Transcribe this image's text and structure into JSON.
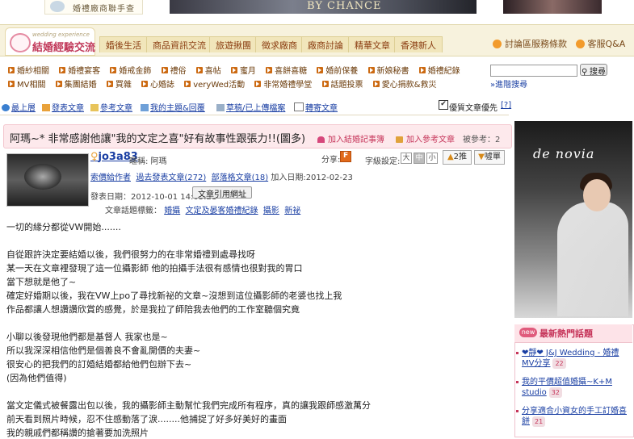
{
  "header": {
    "logo_text": "婚禮廠商聯手查",
    "banner_text": "BY CHANCE"
  },
  "nav": {
    "brand_sub": "wedding experience",
    "brand_title": "結婚經驗交流",
    "tabs": [
      "婚後生活",
      "商品資訊交流",
      "旅遊揪團",
      "徵求廠商",
      "廠商討論",
      "精華文章",
      "香港新人"
    ],
    "right_links": [
      "討論區服務條款",
      "客服Q&A"
    ]
  },
  "categories": {
    "row1": [
      "婚紗相關",
      "婚禮宴客",
      "婚戒金飾",
      "禮俗",
      "喜帖",
      "蜜月",
      "喜餅喜糖",
      "婚前保養",
      "新娘秘書",
      "婚禮紀錄"
    ],
    "row2": [
      "MV相關",
      "集團結婚",
      "買雜",
      "心婚誌",
      "veryWed活動",
      "非常婚禮學堂",
      "話題投票",
      "愛心捐款&救災"
    ]
  },
  "search": {
    "placeholder": "",
    "button_label": "搜尋",
    "advanced_label": "»進階搜尋"
  },
  "toolbar": {
    "items": [
      "最上層",
      "發表文章",
      "參考文章",
      "我的主題&回覆",
      "草稿/已上傳檔案",
      "轉寄文章"
    ],
    "quality_label": "優質文章優先",
    "quality_checked": "✔",
    "help_label": "[?]"
  },
  "post": {
    "title": "阿瑪~* 非常感謝他讓\"我的文定之喜\"好有故事性跟張力!!(圖多)",
    "add_record": "加入結婚記事簿",
    "add_reference": "加入參考文章",
    "reference_count": "被參考：2",
    "author": {
      "username": "jo3a83",
      "nickname_label": "暱稱: 阿瑪",
      "links": [
        "索價給作者",
        "過去發表文章(272)",
        "部落格文章(18)"
      ],
      "join_date": "加入日期:2012-02-23",
      "posted": "發表日期：2012-10-01 14:03:21",
      "copy_link_label": "文章引用網址",
      "tags_label": "文章話題標籤：",
      "tags": [
        "婚攝",
        "文定及晏客婚禮紀錄",
        "攝影",
        "新祕"
      ]
    },
    "share_label": "分享:",
    "share_icon": "F",
    "font_label": "字級設定:",
    "font_sizes": [
      "大",
      "中",
      "小"
    ],
    "push_label": "2推",
    "boo_label": "噓單",
    "body": [
      "一切的緣分都從VW開始.......",
      "",
      "自從跟許決定要結婚以後，我們很努力的在非常婚禮到處尋找呀",
      "某一天在文章裡發現了這一位攝影師 他的拍攝手法很有感情也很對我的胃口",
      "當下想就是他了~",
      "確定好婚期以後，我在VW上po了尋找新祕的文章~沒想到這位攝影師的老婆也找上我",
      "作品都讓人想讚讚欣賞的感覺，於是我拉了師陪我去他們的工作室聽個究竟",
      "",
      "小聊以後發現他們都是基督人 我家也是~",
      "所以我深深相信他們是個善良不會亂開價的夫妻~",
      "很安心的把我們的訂婚結婚都給他們包辦下去~",
      "(因為他們值得)",
      "",
      "當文定儀式被餐露出包以後，我的攝影師主動幫忙我們完成所有程序，真的讓我跟師感激萬分",
      "前天看到照片時候，忍不住感動落了淚........他捕捉了好多好美好的畫面",
      "我的親戚們都稱讚的搶著要加洗照片"
    ]
  },
  "sidebar": {
    "ad_text": "de novia",
    "hot_new_badge": "new",
    "hot_title": "最新熱門話題",
    "hot_items": [
      {
        "text": "❤靜❤ J&J Wedding - 婚禮MV分享",
        "count": "22"
      },
      {
        "text": "我的平價超值婚攝~K+M studio",
        "count": "32"
      },
      {
        "text": "分享適合小資女的手工訂婚喜餅",
        "count": "21"
      }
    ]
  }
}
